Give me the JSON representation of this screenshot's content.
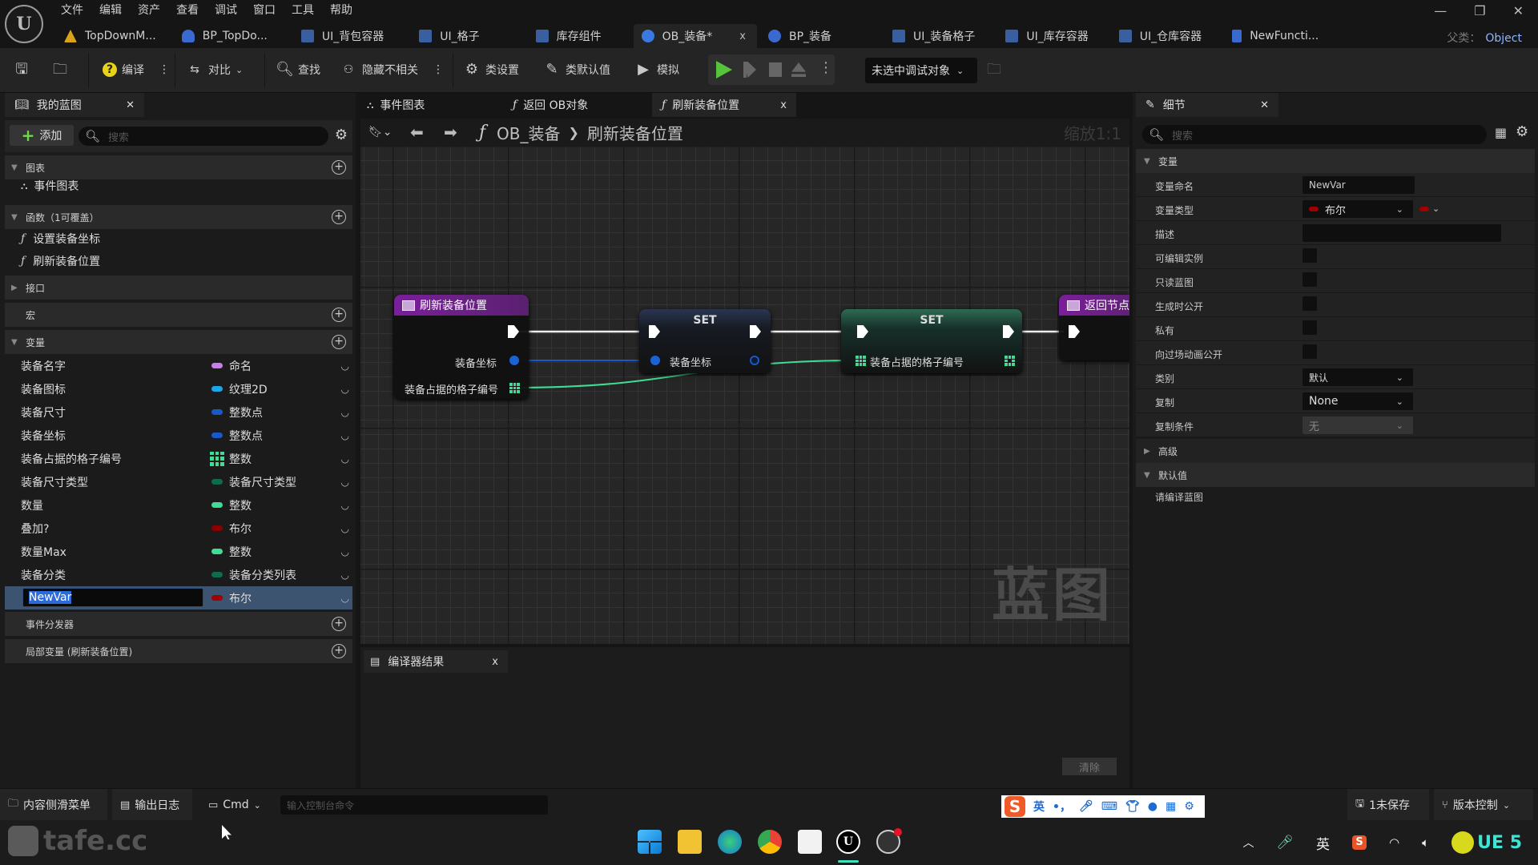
{
  "menu": [
    "文件",
    "编辑",
    "资产",
    "查看",
    "调试",
    "窗口",
    "工具",
    "帮助"
  ],
  "doc_tabs": [
    {
      "label": "TopDownM...",
      "icon": "level-icon",
      "color": "#d9a31a"
    },
    {
      "label": "BP_TopDo...",
      "icon": "character-blueprint-icon",
      "color": "#3a6ad0"
    },
    {
      "label": "UI_背包容器",
      "icon": "widget-blueprint-icon",
      "color": "#3a5fa0"
    },
    {
      "label": "UI_格子",
      "icon": "widget-blueprint-icon",
      "color": "#3a5fa0"
    },
    {
      "label": "库存组件",
      "icon": "component-blueprint-icon",
      "color": "#3a5fa0"
    },
    {
      "label": "OB_装备*",
      "icon": "object-blueprint-icon",
      "color": "#3a7ae0",
      "active": true,
      "close": "x"
    },
    {
      "label": "BP_装备",
      "icon": "actor-blueprint-icon",
      "color": "#3a6ad0"
    },
    {
      "label": "UI_装备格子",
      "icon": "widget-blueprint-icon",
      "color": "#3a5fa0"
    },
    {
      "label": "UI_库存容器",
      "icon": "widget-blueprint-icon",
      "color": "#3a5fa0"
    },
    {
      "label": "UI_仓库容器",
      "icon": "widget-blueprint-icon",
      "color": "#3a5fa0"
    },
    {
      "label": "NewFuncti...",
      "icon": "function-library-icon",
      "color": "#3a6ad0"
    }
  ],
  "parent_class": {
    "label": "父类：",
    "value": "Object"
  },
  "window_controls": {
    "minimize": "—",
    "restore": "❐",
    "close": "✕"
  },
  "toolbar": {
    "compile": "编译",
    "diff": "对比",
    "find": "查找",
    "hide_unrelated": "隐藏不相关",
    "class_settings": "类设置",
    "class_defaults": "类默认值",
    "simulate": "模拟",
    "debug_target": "未选中调试对象"
  },
  "my_blueprint": {
    "tab_label": "我的蓝图",
    "add_label": "添加",
    "search_placeholder": "搜索",
    "sections": {
      "graphs": "图表",
      "functions": "函数（1可覆盖）",
      "interfaces": "接口",
      "macros": "宏",
      "variables": "变量",
      "event_dispatchers": "事件分发器",
      "local_variables": "局部变量 (刷新装备位置)"
    },
    "graphs": [
      "事件图表"
    ],
    "functions": [
      "设置装备坐标",
      "刷新装备位置"
    ],
    "variables": [
      {
        "name": "装备名字",
        "type": "命名",
        "color": "#c67ee8"
      },
      {
        "name": "装备图标",
        "type": "纹理2D",
        "color": "#1ca6e8"
      },
      {
        "name": "装备尺寸",
        "type": "整数点",
        "color": "#1a58c8"
      },
      {
        "name": "装备坐标",
        "type": "整数点",
        "color": "#1a58c8"
      },
      {
        "name": "装备占据的格子编号",
        "type": "整数",
        "color": "#3fdd94",
        "is_array": true
      },
      {
        "name": "装备尺寸类型",
        "type": "装备尺寸类型",
        "color": "#0f6b4e"
      },
      {
        "name": "数量",
        "type": "整数",
        "color": "#3fdd94"
      },
      {
        "name": "叠加?",
        "type": "布尔",
        "color": "#8a0000"
      },
      {
        "name": "数量Max",
        "type": "整数",
        "color": "#3fdd94"
      },
      {
        "name": "装备分类",
        "type": "装备分类列表",
        "color": "#0f6b4e"
      },
      {
        "name": "NewVar",
        "type": "布尔",
        "color": "#a00000",
        "selected": true,
        "editing": true
      }
    ]
  },
  "graph_tabs": [
    {
      "label": "事件图表",
      "icon": "event-graph-icon"
    },
    {
      "label": "返回 OB对象",
      "icon": "function-icon"
    },
    {
      "label": "刷新装备位置",
      "icon": "function-icon",
      "active": true,
      "close": "x"
    }
  ],
  "breadcrumb": {
    "root": "OB_装备",
    "sep": "❯",
    "current": "刷新装备位置"
  },
  "zoom_label": "缩放1:1",
  "graph_watermark": "蓝图",
  "nodes": {
    "entry": {
      "title": "刷新装备位置",
      "pins": [
        "装备坐标",
        "装备占据的格子编号"
      ]
    },
    "set1": {
      "title": "SET",
      "pin": "装备坐标"
    },
    "set2": {
      "title": "SET",
      "pin": "装备占据的格子编号"
    },
    "return": {
      "title": "返回节点"
    }
  },
  "compiler": {
    "tab_label": "编译器结果",
    "close": "x",
    "clear_label": "清除"
  },
  "details": {
    "tab_label": "细节",
    "search_placeholder": "搜索",
    "section_variable": "变量",
    "rows": {
      "var_name_label": "变量命名",
      "var_name_value": "NewVar",
      "var_type_label": "变量类型",
      "var_type_value": "布尔",
      "description_label": "描述",
      "instance_editable": "可编辑实例",
      "blueprint_readonly": "只读蓝图",
      "expose_on_spawn": "生成时公开",
      "private": "私有",
      "expose_to_cinematics": "向过场动画公开",
      "category_label": "类别",
      "category_value": "默认",
      "replication_label": "复制",
      "replication_value": "None",
      "replication_condition_label": "复制条件",
      "replication_condition_value": "无"
    },
    "section_advanced": "高级",
    "section_default": "默认值",
    "default_hint": "请编译蓝图"
  },
  "statusbar": {
    "content_drawer": "内容侧滑菜单",
    "output_log": "输出日志",
    "cmd": "Cmd",
    "cmd_placeholder": "输入控制台命令",
    "unsaved": "1未保存",
    "source_control": "版本控制"
  },
  "ime": {
    "lang": "英",
    "punct": "•，"
  },
  "taskbar": {
    "watermark": "tafe.cc",
    "tray_lang": "英",
    "ue_badge": "UE 5"
  }
}
